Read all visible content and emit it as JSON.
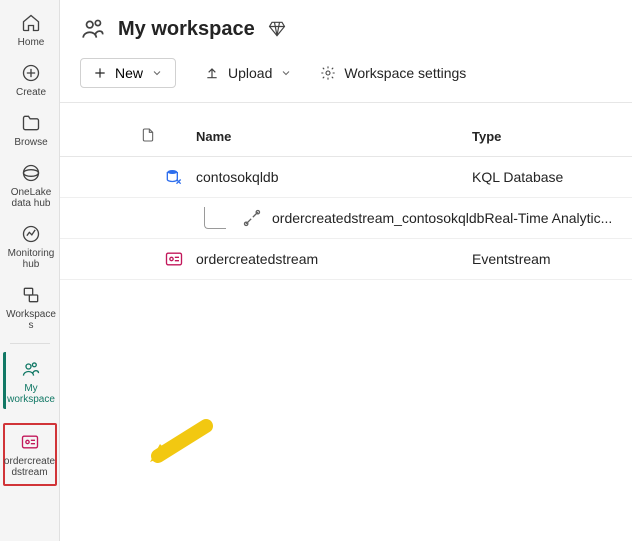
{
  "rail": {
    "home": "Home",
    "create": "Create",
    "browse": "Browse",
    "onelake": "OneLake data hub",
    "monitoring": "Monitoring hub",
    "workspaces": "Workspaces",
    "myworkspace": "My workspace",
    "ordercreatedstream": "ordercreatedstream"
  },
  "header": {
    "title": "My workspace"
  },
  "toolbar": {
    "new": "New",
    "upload": "Upload",
    "settings": "Workspace settings"
  },
  "table": {
    "headers": {
      "name": "Name",
      "type": "Type"
    },
    "rows": [
      {
        "name": "contosokqldb",
        "type": "KQL Database"
      },
      {
        "name": "ordercreatedstream_contosokqldb",
        "type": "Real-Time Analytic..."
      },
      {
        "name": "ordercreatedstream",
        "type": "Eventstream"
      }
    ]
  }
}
